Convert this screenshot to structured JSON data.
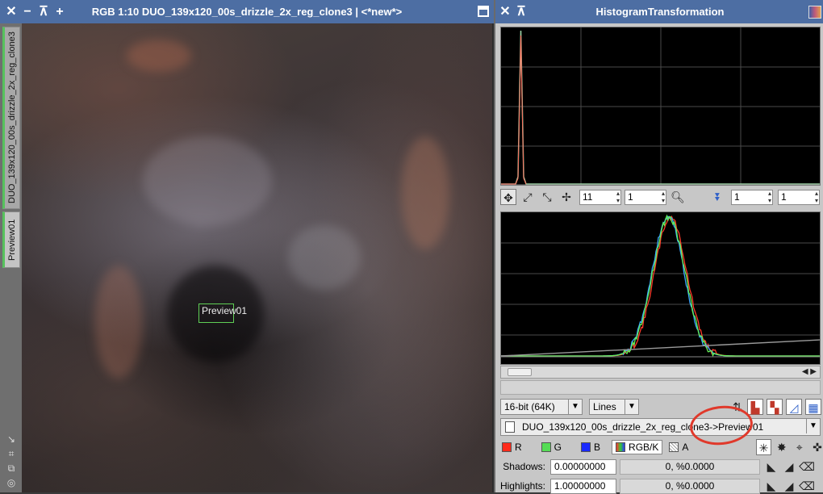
{
  "image_window": {
    "title": "RGB 1:10 DUO_139x120_00s_drizzle_2x_reg_clone3 | <*new*>",
    "controls": [
      "✕",
      "−",
      "⊼",
      "+"
    ],
    "tabs": {
      "main": "DUO_139x120_00s_drizzle_2x_reg_clone3",
      "preview": "Preview01"
    },
    "preview_label": "Preview01"
  },
  "hist_window": {
    "title": "HistogramTransformation",
    "controls": [
      "✕",
      "⊼"
    ],
    "zoom": {
      "h_zoom": "11",
      "v_zoom": "1",
      "right_h": "1",
      "right_v": "1"
    },
    "depth_combo": "16-bit (64K)",
    "mode_combo": "Lines",
    "view_selector": "DUO_139x120_00s_drizzle_2x_reg_clone3->Preview01",
    "channels": [
      {
        "label": "R",
        "color": "#ff2a1a"
      },
      {
        "label": "G",
        "color": "#55dd55"
      },
      {
        "label": "B",
        "color": "#1a2aff"
      },
      {
        "label": "RGB/K",
        "color": "rgb"
      },
      {
        "label": "A",
        "color": "#ffffff"
      }
    ],
    "shadows": {
      "label": "Shadows:",
      "value": "0.00000000",
      "readout": "0, %0.0000"
    },
    "highlights": {
      "label": "Highlights:",
      "value": "1.00000000",
      "readout": "0, %0.0000"
    }
  },
  "colors": {
    "titlebar": "#4d6ea3",
    "annotation": "#e0392b",
    "preview_border": "#5fcf55"
  }
}
